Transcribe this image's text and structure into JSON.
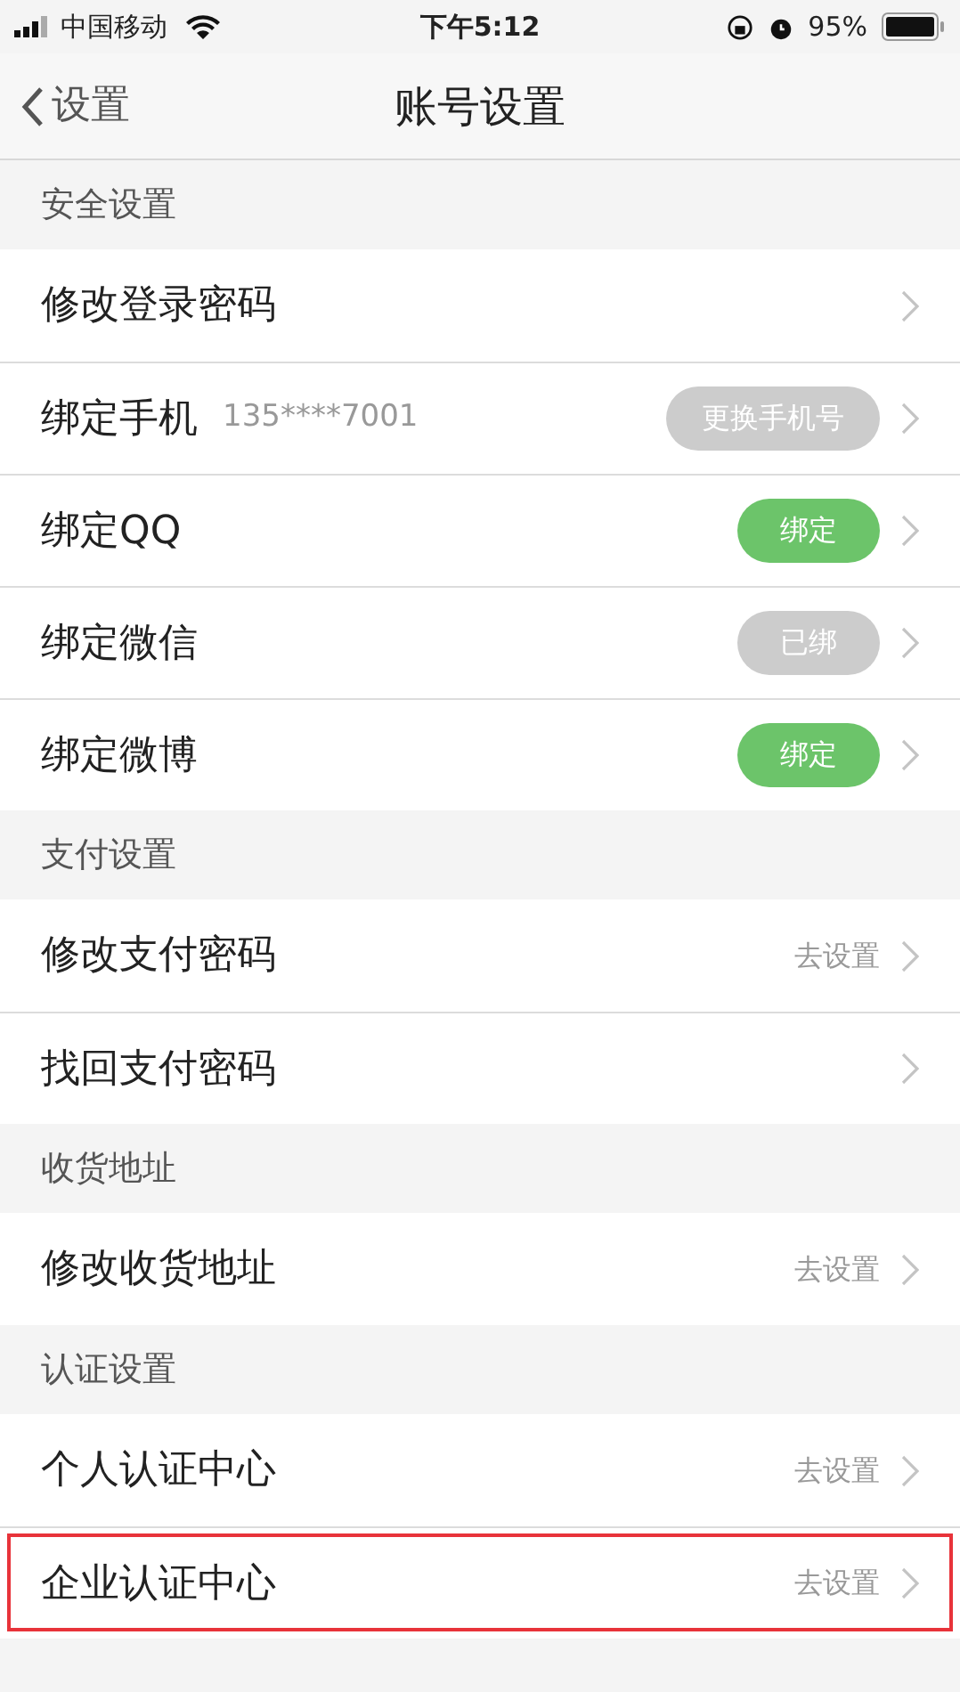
{
  "status_bar": {
    "carrier": "中国移动",
    "time": "下午5:12",
    "battery": "95%"
  },
  "nav": {
    "back": "设置",
    "title": "账号设置"
  },
  "sections": [
    {
      "header": "安全设置",
      "rows": [
        {
          "label": "修改登录密码",
          "highlighted": false
        },
        {
          "label": "绑定手机",
          "detail": "135****7001",
          "badge": {
            "text": "更换手机号",
            "color": "#cccccc"
          },
          "highlighted": false
        },
        {
          "label": "绑定QQ",
          "badge": {
            "text": "绑定",
            "color": "#6cc46a"
          },
          "highlighted": false
        },
        {
          "label": "绑定微信",
          "badge": {
            "text": "已绑",
            "color": "#cccccc"
          },
          "highlighted": false
        },
        {
          "label": "绑定微博",
          "badge": {
            "text": "绑定",
            "color": "#6cc46a"
          },
          "highlighted": false
        }
      ]
    },
    {
      "header": "支付设置",
      "rows": [
        {
          "label": "修改支付密码",
          "value": "去设置",
          "highlighted": false
        },
        {
          "label": "找回支付密码",
          "highlighted": false
        }
      ]
    },
    {
      "header": "收货地址",
      "rows": [
        {
          "label": "修改收货地址",
          "value": "去设置",
          "highlighted": false
        }
      ]
    },
    {
      "header": "认证设置",
      "rows": [
        {
          "label": "个人认证中心",
          "value": "去设置",
          "highlighted": false
        },
        {
          "label": "企业认证中心",
          "value": "去设置",
          "highlighted": true
        }
      ]
    }
  ]
}
